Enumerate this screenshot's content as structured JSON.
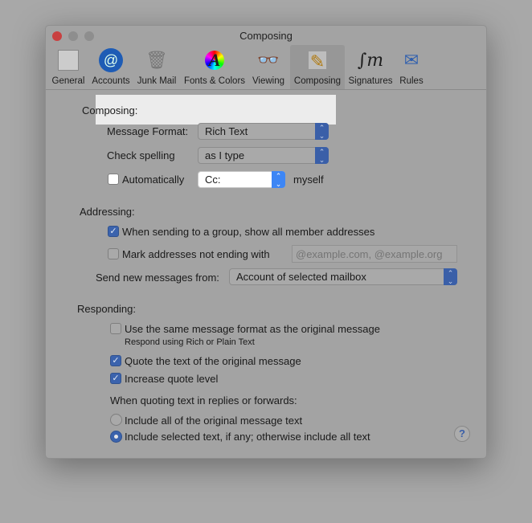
{
  "window": {
    "title": "Composing"
  },
  "toolbar": [
    {
      "label": "General",
      "icon": "switch-icon"
    },
    {
      "label": "Accounts",
      "icon": "at-icon"
    },
    {
      "label": "Junk Mail",
      "icon": "trash-icon"
    },
    {
      "label": "Fonts & Colors",
      "icon": "font-icon"
    },
    {
      "label": "Viewing",
      "icon": "glasses-icon"
    },
    {
      "label": "Composing",
      "icon": "pencil-icon",
      "selected": true
    },
    {
      "label": "Signatures",
      "icon": "signature-icon"
    },
    {
      "label": "Rules",
      "icon": "rules-icon"
    }
  ],
  "composing": {
    "heading": "Composing:",
    "format_label": "Message Format:",
    "format_value": "Rich Text",
    "spell_label": "Check spelling",
    "spell_value": "as I type",
    "auto_label": "Automatically",
    "auto_checked": false,
    "auto_value": "Cc:",
    "auto_suffix": "myself"
  },
  "addressing": {
    "heading": "Addressing:",
    "group_label": "When sending to a group, show all member addresses",
    "group_checked": true,
    "mark_label": "Mark addresses not ending with",
    "mark_checked": false,
    "mark_placeholder": "@example.com, @example.org",
    "send_label": "Send new messages from:",
    "send_value": "Account of selected mailbox"
  },
  "responding": {
    "heading": "Responding:",
    "same_label": "Use the same message format as the original message",
    "same_sub": "Respond using Rich or Plain Text",
    "same_checked": false,
    "quote_label": "Quote the text of the original message",
    "quote_checked": true,
    "level_label": "Increase quote level",
    "level_checked": true,
    "when_label": "When quoting text in replies or forwards:",
    "radio_all": "Include all of the original message text",
    "radio_sel": "Include selected text, if any; otherwise include all text",
    "selected_radio": "selected"
  },
  "help": "?",
  "colors": {
    "accent": "#3b63ad",
    "close": "#c94040"
  }
}
